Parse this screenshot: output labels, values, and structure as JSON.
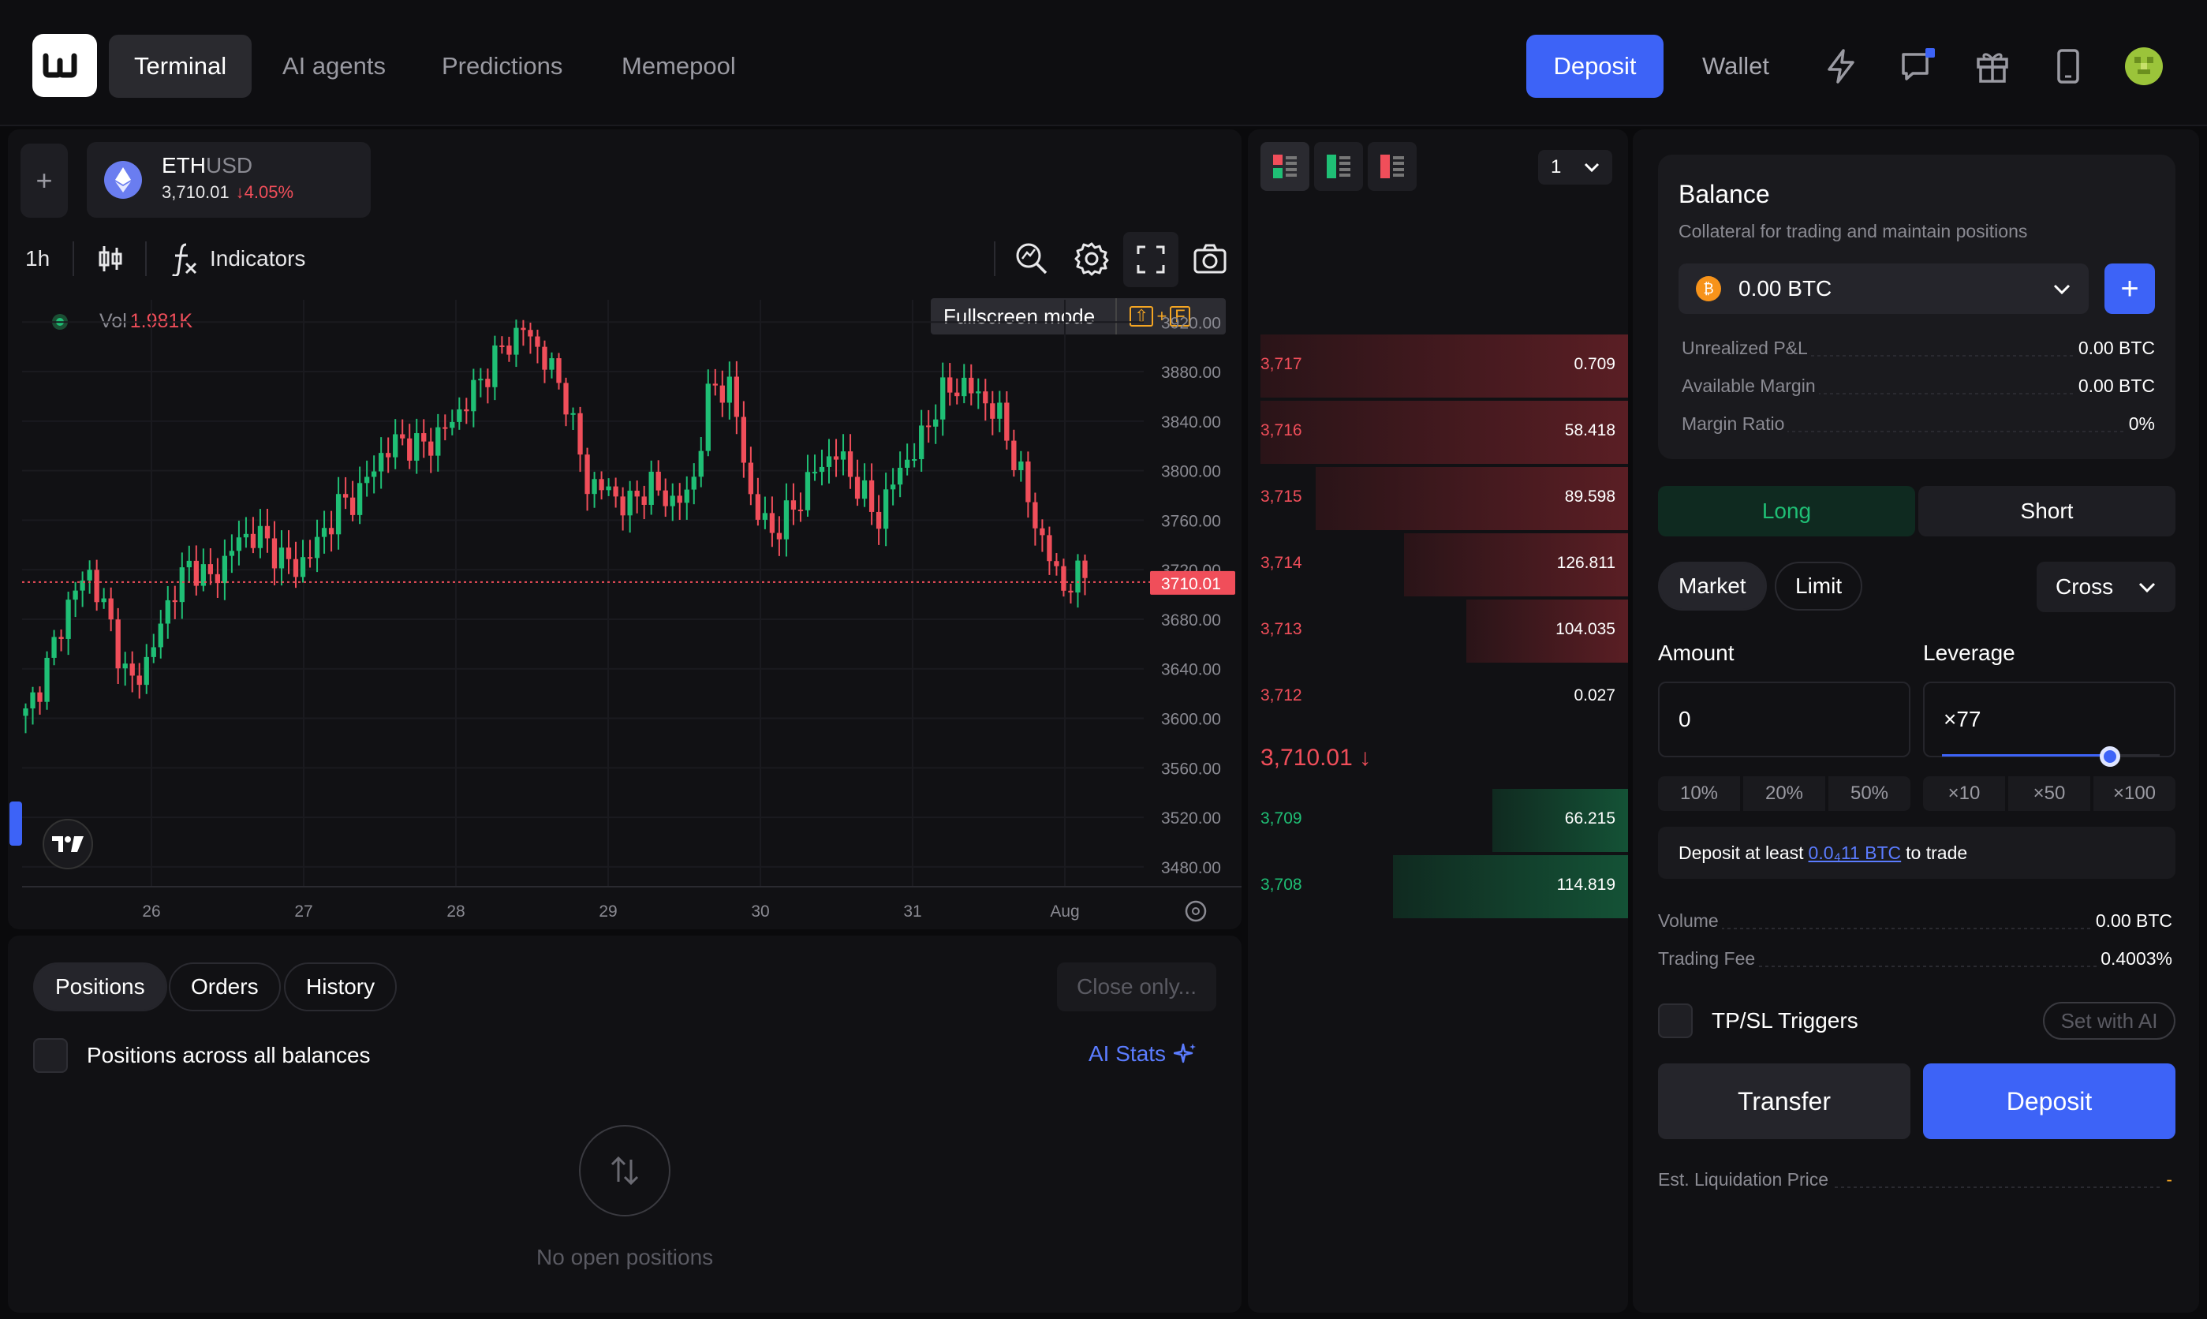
{
  "nav": {
    "tabs": [
      {
        "label": "Terminal",
        "active": true
      },
      {
        "label": "AI agents"
      },
      {
        "label": "Predictions"
      },
      {
        "label": "Memepool"
      }
    ],
    "deposit_label": "Deposit",
    "wallet_label": "Wallet",
    "icons": [
      "bolt-icon",
      "chat-icon",
      "gift-icon",
      "mobile-icon",
      "avatar"
    ]
  },
  "symbol": {
    "base": "ETH",
    "quote": "USD",
    "price": "3,710.01",
    "change": "↓4.05%"
  },
  "chart_toolbar": {
    "interval": "1h",
    "indicators_label": "Indicators",
    "tooltip_label": "Fullscreen mode",
    "tooltip_keys": [
      "⇧",
      "+",
      "F"
    ]
  },
  "volume": {
    "label": "Vol",
    "value": "1.981K"
  },
  "chart_data": {
    "type": "candlestick",
    "symbol": "ETHUSD",
    "interval": "1h",
    "x_tick_labels": [
      "26",
      "27",
      "28",
      "29",
      "30",
      "31",
      "Aug"
    ],
    "y_tick_labels": [
      "3920.00",
      "3880.00",
      "3840.00",
      "3800.00",
      "3760.00",
      "3720.00",
      "3680.00",
      "3640.00",
      "3600.00",
      "3560.00",
      "3520.00",
      "3480.00"
    ],
    "ylim": [
      3464,
      3938
    ],
    "last_price": 3710.01,
    "last_price_label": "3710.01",
    "colors": {
      "up": "#1fbf75",
      "down": "#f04e5a"
    },
    "close_path": [
      3602,
      3640,
      3690,
      3720,
      3680,
      3625,
      3650,
      3700,
      3725,
      3710,
      3740,
      3750,
      3735,
      3720,
      3740,
      3770,
      3780,
      3810,
      3825,
      3818,
      3830,
      3850,
      3875,
      3900,
      3915,
      3890,
      3860,
      3790,
      3785,
      3770,
      3790,
      3775,
      3780,
      3870,
      3865,
      3770,
      3750,
      3770,
      3800,
      3815,
      3790,
      3760,
      3800,
      3820,
      3860,
      3870,
      3860,
      3840,
      3790,
      3740,
      3705,
      3718
    ]
  },
  "orderbook": {
    "depth_select": "1",
    "asks": [
      {
        "price": "3,717",
        "size": "0.709",
        "depth": 1.0
      },
      {
        "price": "3,716",
        "size": "58.418",
        "depth": 1.0
      },
      {
        "price": "3,715",
        "size": "89.598",
        "depth": 0.85
      },
      {
        "price": "3,714",
        "size": "126.811",
        "depth": 0.61
      },
      {
        "price": "3,713",
        "size": "104.035",
        "depth": 0.44
      },
      {
        "price": "3,712",
        "size": "0.027",
        "depth": 0.0
      }
    ],
    "mid_price": "3,710.01 ↓",
    "bids": [
      {
        "price": "3,709",
        "size": "66.215",
        "depth": 0.37
      },
      {
        "price": "3,708",
        "size": "114.819",
        "depth": 0.64
      }
    ]
  },
  "positions": {
    "tabs": [
      "Positions",
      "Orders",
      "History"
    ],
    "close_only_label": "Close only...",
    "checkbox_label": "Positions across all balances",
    "ai_stats_label": "AI Stats",
    "empty_label": "No open positions"
  },
  "trade": {
    "balance_title": "Balance",
    "balance_sub": "Collateral for trading and maintain positions",
    "balance_value": "0.00 BTC",
    "rows": [
      {
        "k": "Unrealized P&L",
        "v": "0.00 BTC"
      },
      {
        "k": "Available Margin",
        "v": "0.00 BTC"
      },
      {
        "k": "Margin Ratio",
        "v": "0%"
      }
    ],
    "long_label": "Long",
    "short_label": "Short",
    "order_types": [
      "Market",
      "Limit"
    ],
    "margin_mode": "Cross",
    "amount_label": "Amount",
    "amount_value": "0",
    "leverage_label": "Leverage",
    "leverage_value": "×77",
    "leverage_fraction": 0.77,
    "pct_buttons": [
      "10%",
      "20%",
      "50%"
    ],
    "lev_buttons": [
      "×10",
      "×50",
      "×100"
    ],
    "hint_prefix": "Deposit at least",
    "hint_link": "0.0₄11 BTC",
    "hint_suffix": "to trade",
    "volume_label": "Volume",
    "volume_value": "0.00 BTC",
    "fee_label": "Trading Fee",
    "fee_value": "0.4003%",
    "tpsl_label": "TP/SL Triggers",
    "set_ai_label": "Set with AI",
    "transfer_label": "Transfer",
    "deposit_label": "Deposit",
    "liq_label": "Est. Liquidation Price",
    "liq_value": "-"
  }
}
